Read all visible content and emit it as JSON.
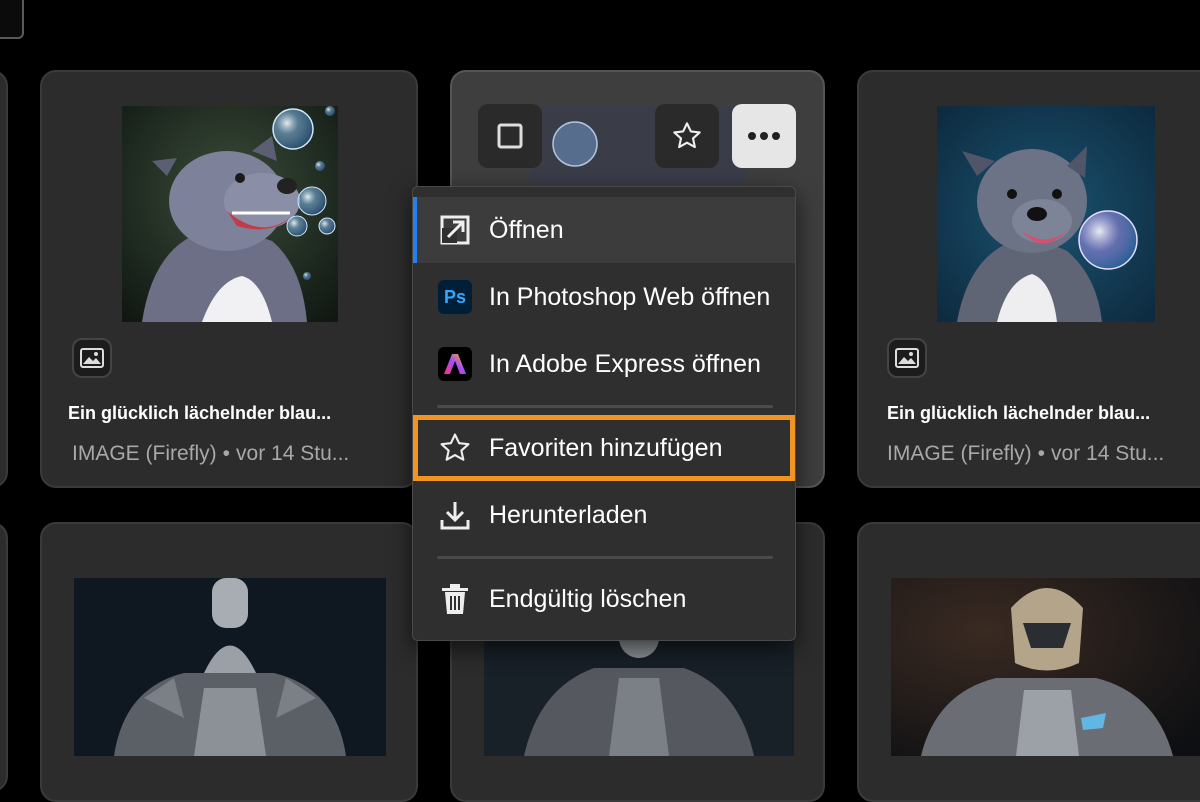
{
  "cards": [
    {
      "title": "Ein glücklich lächelnder blau...",
      "type": "IMAGE (Firefly)",
      "age": "vor 14 Stu..."
    },
    {
      "title": "Ein glücklich lächelnder blau...",
      "type": "IMAGE (Firefly)",
      "age": "vor 14 Stu..."
    }
  ],
  "meta_separator": "•",
  "context_menu": {
    "items": [
      {
        "label": "Öffnen",
        "icon": "open-icon"
      },
      {
        "label": "In Photoshop Web öffnen",
        "icon": "photoshop-icon",
        "badge": "Ps"
      },
      {
        "label": "In Adobe Express öffnen",
        "icon": "adobe-express-icon"
      },
      {
        "label": "Favoriten hinzufügen",
        "icon": "star-icon"
      },
      {
        "label": "Herunterladen",
        "icon": "download-icon"
      },
      {
        "label": "Endgültig löschen",
        "icon": "trash-icon"
      }
    ]
  },
  "colors": {
    "background": "#000000",
    "card": "#2c2c2c",
    "menu": "#2f2f2f",
    "highlight": "#f29423",
    "selection_bar": "#2680eb"
  }
}
